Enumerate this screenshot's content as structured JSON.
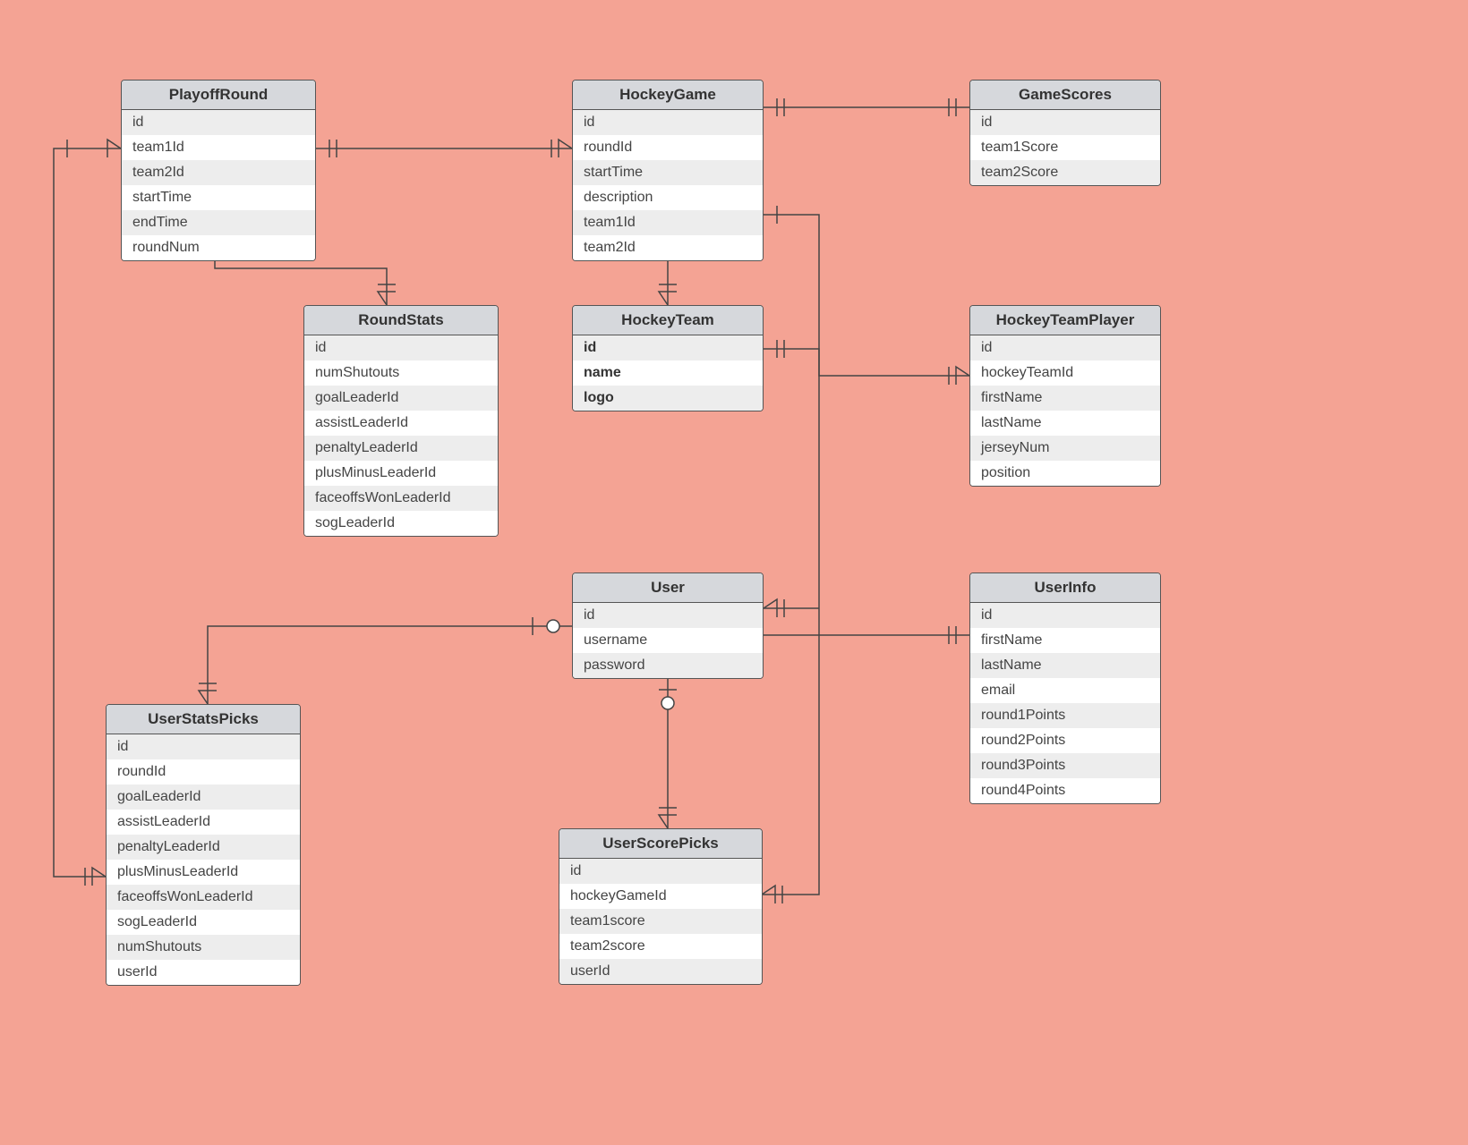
{
  "entities": {
    "playoffRound": {
      "title": "PlayoffRound",
      "fields": [
        "id",
        "team1Id",
        "team2Id",
        "startTime",
        "endTime",
        "roundNum"
      ]
    },
    "hockeyGame": {
      "title": "HockeyGame",
      "fields": [
        "id",
        "roundId",
        "startTime",
        "description",
        "team1Id",
        "team2Id"
      ]
    },
    "gameScores": {
      "title": "GameScores",
      "fields": [
        "id",
        "team1Score",
        "team2Score"
      ]
    },
    "roundStats": {
      "title": "RoundStats",
      "fields": [
        "id",
        "numShutouts",
        "goalLeaderId",
        "assistLeaderId",
        "penaltyLeaderId",
        "plusMinusLeaderId",
        "faceoffsWonLeaderId",
        "sogLeaderId"
      ]
    },
    "hockeyTeam": {
      "title": "HockeyTeam",
      "fields": [
        "id",
        "name",
        "logo"
      ]
    },
    "hockeyTeamPlayer": {
      "title": "HockeyTeamPlayer",
      "fields": [
        "id",
        "hockeyTeamId",
        "firstName",
        "lastName",
        "jerseyNum",
        "position"
      ]
    },
    "user": {
      "title": "User",
      "fields": [
        "id",
        "username",
        "password"
      ]
    },
    "userInfo": {
      "title": "UserInfo",
      "fields": [
        "id",
        "firstName",
        "lastName",
        "email",
        "round1Points",
        "round2Points",
        "round3Points",
        "round4Points"
      ]
    },
    "userStatsPicks": {
      "title": "UserStatsPicks",
      "fields": [
        "id",
        "roundId",
        "goalLeaderId",
        "assistLeaderId",
        "penaltyLeaderId",
        "plusMinusLeaderId",
        "faceoffsWonLeaderId",
        "sogLeaderId",
        "numShutouts",
        "userId"
      ]
    },
    "userScorePicks": {
      "title": "UserScorePicks",
      "fields": [
        "id",
        "hockeyGameId",
        "team1score",
        "team2score",
        "userId"
      ]
    }
  }
}
